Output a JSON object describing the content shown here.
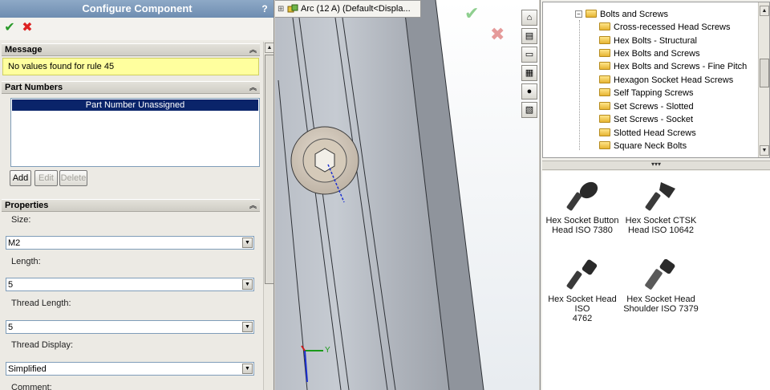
{
  "left_panel": {
    "title": "Configure Component",
    "help": "?",
    "ok": "✔",
    "cancel": "✖",
    "groups": {
      "message": {
        "title": "Message",
        "text": "No values found for rule 45"
      },
      "part_numbers": {
        "title": "Part Numbers",
        "selected_row": "Part Number Unassigned",
        "buttons": {
          "add": "Add",
          "edit": "Edit",
          "delete": "Delete"
        }
      },
      "properties": {
        "title": "Properties",
        "fields": [
          {
            "label": "Size:",
            "value": "M2"
          },
          {
            "label": "Length:",
            "value": "5"
          },
          {
            "label": "Thread Length:",
            "value": "5"
          },
          {
            "label": "Thread Display:",
            "value": "Simplified"
          }
        ],
        "next_label": "Comment:"
      }
    }
  },
  "graphics": {
    "flyout_text": "Arc (12 A)  (Default<Displa...",
    "flyout_expander": "⊞",
    "ok": "✔",
    "cancel": "✖",
    "axis_y": "Y"
  },
  "task_pane": {
    "tabs": [
      "home-icon",
      "design-library-icon",
      "file-explorer-icon",
      "view-palette-icon",
      "appearances-icon",
      "custom-properties-icon"
    ]
  },
  "design_library": {
    "tree": {
      "parent": "Bolts and Screws",
      "parent_expander": "−",
      "children": [
        "Cross-recessed Head Screws",
        "Hex Bolts - Structural",
        "Hex Bolts and Screws",
        "Hex Bolts and Screws - Fine Pitch",
        "Hexagon Socket Head Screws",
        "Self Tapping Screws",
        "Set Screws - Slotted",
        "Set Screws - Socket",
        "Slotted Head Screws",
        "Square Neck Bolts"
      ]
    },
    "splitter": "▾▾▾",
    "items": [
      {
        "line1": "Hex Socket Button",
        "line2": "Head ISO 7380"
      },
      {
        "line1": "Hex Socket CTSK",
        "line2": "Head ISO 10642"
      },
      {
        "line1": "Hex Socket Head ISO",
        "line2": "4762"
      },
      {
        "line1": "Hex Socket Head",
        "line2": "Shoulder ISO 7379"
      }
    ]
  }
}
